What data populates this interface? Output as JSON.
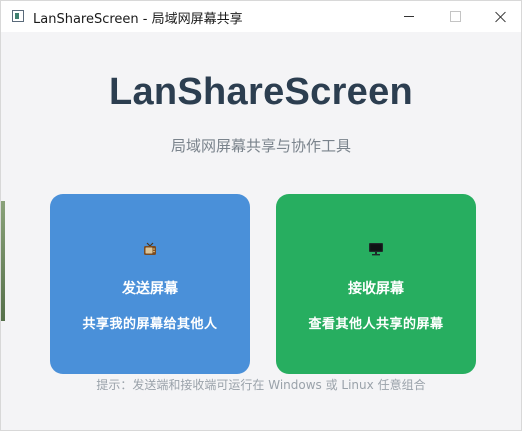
{
  "window": {
    "title": "LanShareScreen - 局域网屏幕共享",
    "controls": [
      "minimize",
      "maximize",
      "close"
    ]
  },
  "main": {
    "app_title": "LanShareScreen",
    "subtitle": "局域网屏幕共享与协作工具",
    "cards": [
      {
        "icon": "tv-icon",
        "title": "发送屏幕",
        "description": "共享我的屏幕给其他人",
        "color": "#4a90d9"
      },
      {
        "icon": "monitor-icon",
        "title": "接收屏幕",
        "description": "查看其他人共享的屏幕",
        "color": "#27ae60"
      }
    ],
    "hint": "提示：发送端和接收端可运行在 Windows 或 Linux 任意组合"
  },
  "colors": {
    "title_text": "#2c3e50",
    "subtitle_text": "#7a838c",
    "background": "#f4f4f6"
  }
}
